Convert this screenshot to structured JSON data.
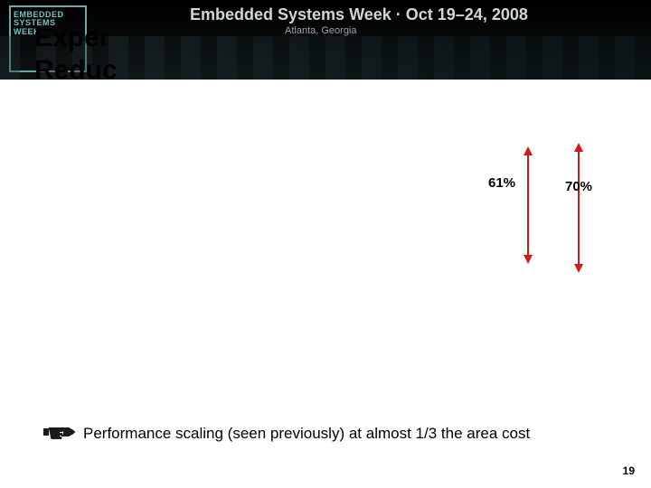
{
  "banner": {
    "logo_line1": "EMBEDDED",
    "logo_line2": "SYSTEMS",
    "logo_line3": "WEEK",
    "title": "Embedded Systems Week · Oct 19–24, 2008",
    "subtitle": "Atlanta, Georgia"
  },
  "title": {
    "line1": "Exper",
    "line2": "Reduc"
  },
  "arrows": {
    "left_label": "61%",
    "right_label": "70%"
  },
  "caption": "Performance scaling (seen previously) at almost 1/3 the area cost",
  "page_number": "19"
}
